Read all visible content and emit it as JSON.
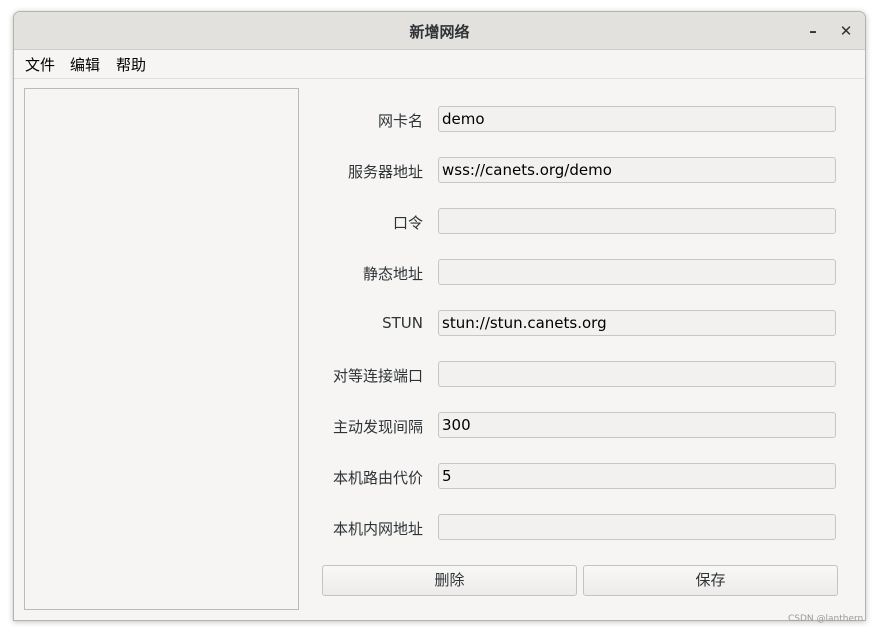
{
  "window": {
    "title": "新增网络",
    "minimize_symbol": "–",
    "close_symbol": "✕"
  },
  "menu": {
    "items": [
      "文件",
      "编辑",
      "帮助"
    ]
  },
  "form": {
    "fields": [
      {
        "label": "网卡名",
        "value": "demo"
      },
      {
        "label": "服务器地址",
        "value": "wss://canets.org/demo"
      },
      {
        "label": "口令",
        "value": ""
      },
      {
        "label": "静态地址",
        "value": ""
      },
      {
        "label": "STUN",
        "value": "stun://stun.canets.org"
      },
      {
        "label": "对等连接端口",
        "value": ""
      },
      {
        "label": "主动发现间隔",
        "value": "300"
      },
      {
        "label": "本机路由代价",
        "value": "5"
      },
      {
        "label": "本机内网地址",
        "value": ""
      }
    ]
  },
  "buttons": {
    "delete_label": "删除",
    "save_label": "保存"
  },
  "watermark": "CSDN @lanthern",
  "colors": {
    "titlebar": "#e3e1de",
    "window_bg": "#f6f5f4",
    "input_bg": "#f2f1f0",
    "border": "#c9c5c0"
  }
}
